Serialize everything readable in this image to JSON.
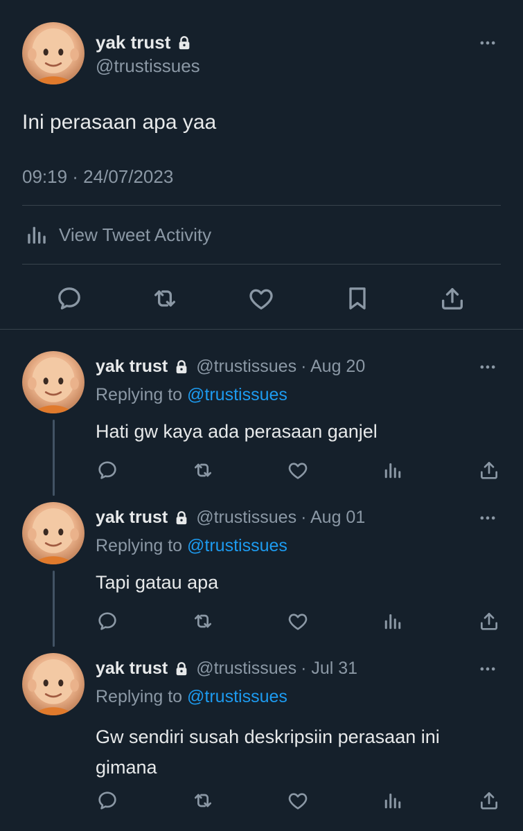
{
  "main_tweet": {
    "author_name": "yak trust",
    "author_handle": "@trustissues",
    "text": "Ini perasaan apa yaa",
    "timestamp": "09:19 · 24/07/2023",
    "activity_label": "View Tweet Activity"
  },
  "replies": [
    {
      "author_name": "yak trust",
      "author_handle": "@trustissues",
      "date": "· Aug 20",
      "replying_prefix": "Replying to",
      "replying_handle": "@trustissues",
      "text": "Hati gw kaya ada perasaan ganjel"
    },
    {
      "author_name": "yak trust",
      "author_handle": "@trustissues",
      "date": "· Aug 01",
      "replying_prefix": "Replying to",
      "replying_handle": "@trustissues",
      "text": "Tapi gatau apa"
    },
    {
      "author_name": "yak trust",
      "author_handle": "@trustissues",
      "date": "· Jul 31",
      "replying_prefix": "Replying to",
      "replying_handle": "@trustissues",
      "text_line1": "Gw sendiri susah deskripsiin perasaan ini",
      "text_line2": "gimana"
    }
  ],
  "colors": {
    "background": "#15202b",
    "text": "#e7e9ea",
    "muted": "#8b98a5",
    "link": "#1d9bf0",
    "divider": "#38444d"
  },
  "icons": {
    "lock": "lock-icon",
    "more": "more-icon",
    "reply": "reply-icon",
    "retweet": "retweet-icon",
    "like": "like-icon",
    "bookmark": "bookmark-icon",
    "share": "share-icon",
    "analytics": "analytics-icon"
  }
}
